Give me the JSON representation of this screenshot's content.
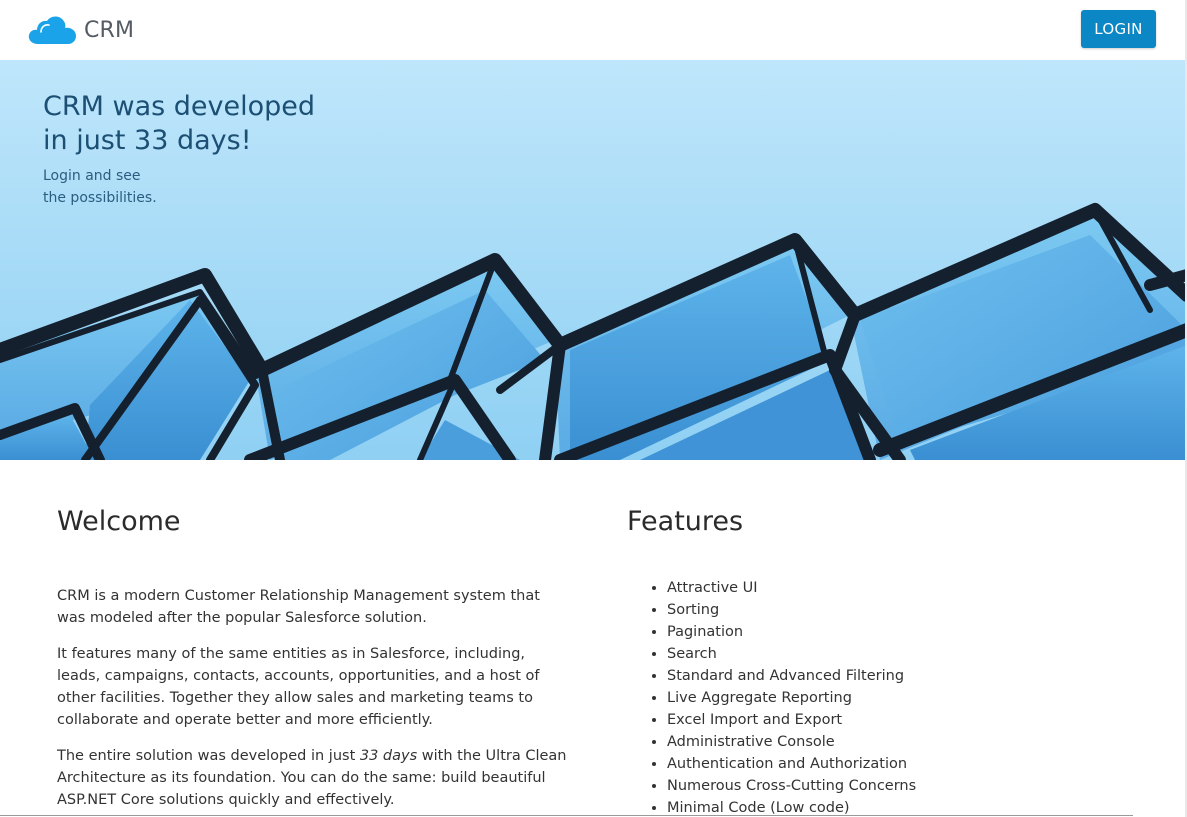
{
  "header": {
    "brand_name": "CRM",
    "login_label": "LOGIN"
  },
  "hero": {
    "title_line1": "CRM was developed",
    "title_line2": "in just 33 days!",
    "subtitle_line1": "Login and see",
    "subtitle_line2": "the possibilities."
  },
  "welcome": {
    "title": "Welcome",
    "p1": "CRM is a modern Customer Relationship Management system that was modeled after the popular Salesforce solution.",
    "p2": "It features many of the same entities as in Salesforce, including, leads, campaigns, contacts, accounts, opportunities, and a host of other facilities. Together they allow sales and marketing teams to collaborate and operate better and more efficiently.",
    "p3_before": "The entire solution was developed in just ",
    "p3_emph": "33 days",
    "p3_after": " with the Ultra Clean Architecture as its foundation. You can do the same: build beautiful ASP.NET Core solutions quickly and effectively."
  },
  "features": {
    "title": "Features",
    "items": [
      "Attractive UI",
      "Sorting",
      "Pagination",
      "Search",
      "Standard and Advanced Filtering",
      "Live Aggregate Reporting",
      "Excel Import and Export",
      "Administrative Console",
      "Authentication and Authorization",
      "Numerous Cross-Cutting Concerns",
      "Minimal Code (Low code)"
    ]
  },
  "colors": {
    "accent": "#0a87c4",
    "brand_cloud": "#1aa3e8",
    "hero_text": "#1b4f73"
  },
  "icons": {
    "brand": "cloud-icon"
  }
}
